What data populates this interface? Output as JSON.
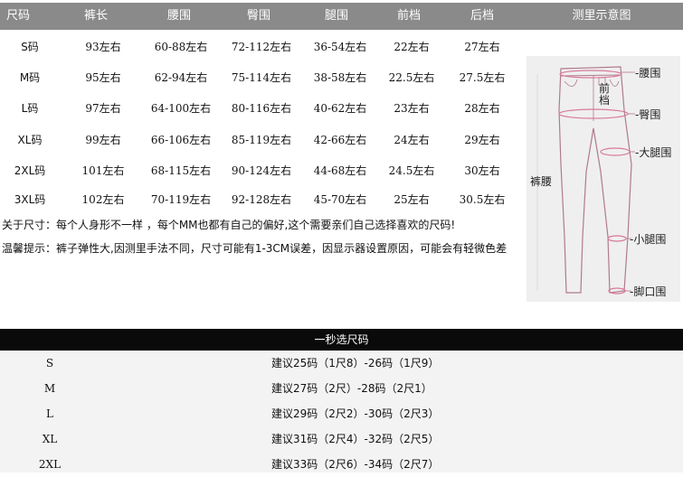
{
  "size_table": {
    "headers": [
      "尺码",
      "裤长",
      "腰围",
      "臀围",
      "腿围",
      "前档",
      "后档",
      "测里示意图"
    ],
    "rows": [
      [
        "S码",
        "93左右",
        "60-88左右",
        "72-112左右",
        "36-54左右",
        "22左右",
        "27左右"
      ],
      [
        "M码",
        "95左右",
        "62-94左右",
        "75-114左右",
        "38-58左右",
        "22.5左右",
        "27.5左右"
      ],
      [
        "L码",
        "97左右",
        "64-100左右",
        "80-116左右",
        "40-62左右",
        "23左右",
        "28左右"
      ],
      [
        "XL码",
        "99左右",
        "66-106左右",
        "85-119左右",
        "42-66左右",
        "24左右",
        "29左右"
      ],
      [
        "2XL码",
        "101左右",
        "68-115左右",
        "90-124左右",
        "44-68左右",
        "24.5左右",
        "30左右"
      ],
      [
        "3XL码",
        "102左右",
        "70-119左右",
        "92-128左右",
        "45-70左右",
        "25左右",
        "30.5左右"
      ]
    ]
  },
  "notes": {
    "fit": "关于尺寸：每个人身形不一样 ，每个MM也都有自己的偏好,这个需要亲们自己选择喜欢的尺码!",
    "tip": "温馨提示：裤子弹性大,因测里手法不同，尺寸可能有1-3CM误差，因显示器设置原因，可能会有轻微色差"
  },
  "diagram": {
    "labels": {
      "waist": "-腰围",
      "front_rise": "前\n档",
      "hip": "-臀围",
      "thigh": "-大腿围",
      "rise": "裤腰",
      "calf": "-小腿围",
      "ankle": "-脚口围"
    },
    "accent_color": "#d9799a",
    "outline_color": "#b07b8a"
  },
  "quick_pick": {
    "title": "一秒选尺码",
    "rows": [
      {
        "size": "S",
        "text": "建议25码（1尺8）-26码（1尺9）"
      },
      {
        "size": "M",
        "text": "建议27码（2尺）-28码（2尺1）"
      },
      {
        "size": "L",
        "text": "建议29码（2尺2）-30码（2尺3）"
      },
      {
        "size": "XL",
        "text": "建议31码（2尺4）-32码（2尺5）"
      },
      {
        "size": "2XL",
        "text": "建议33码（2尺6）-34码（2尺7）"
      }
    ]
  }
}
